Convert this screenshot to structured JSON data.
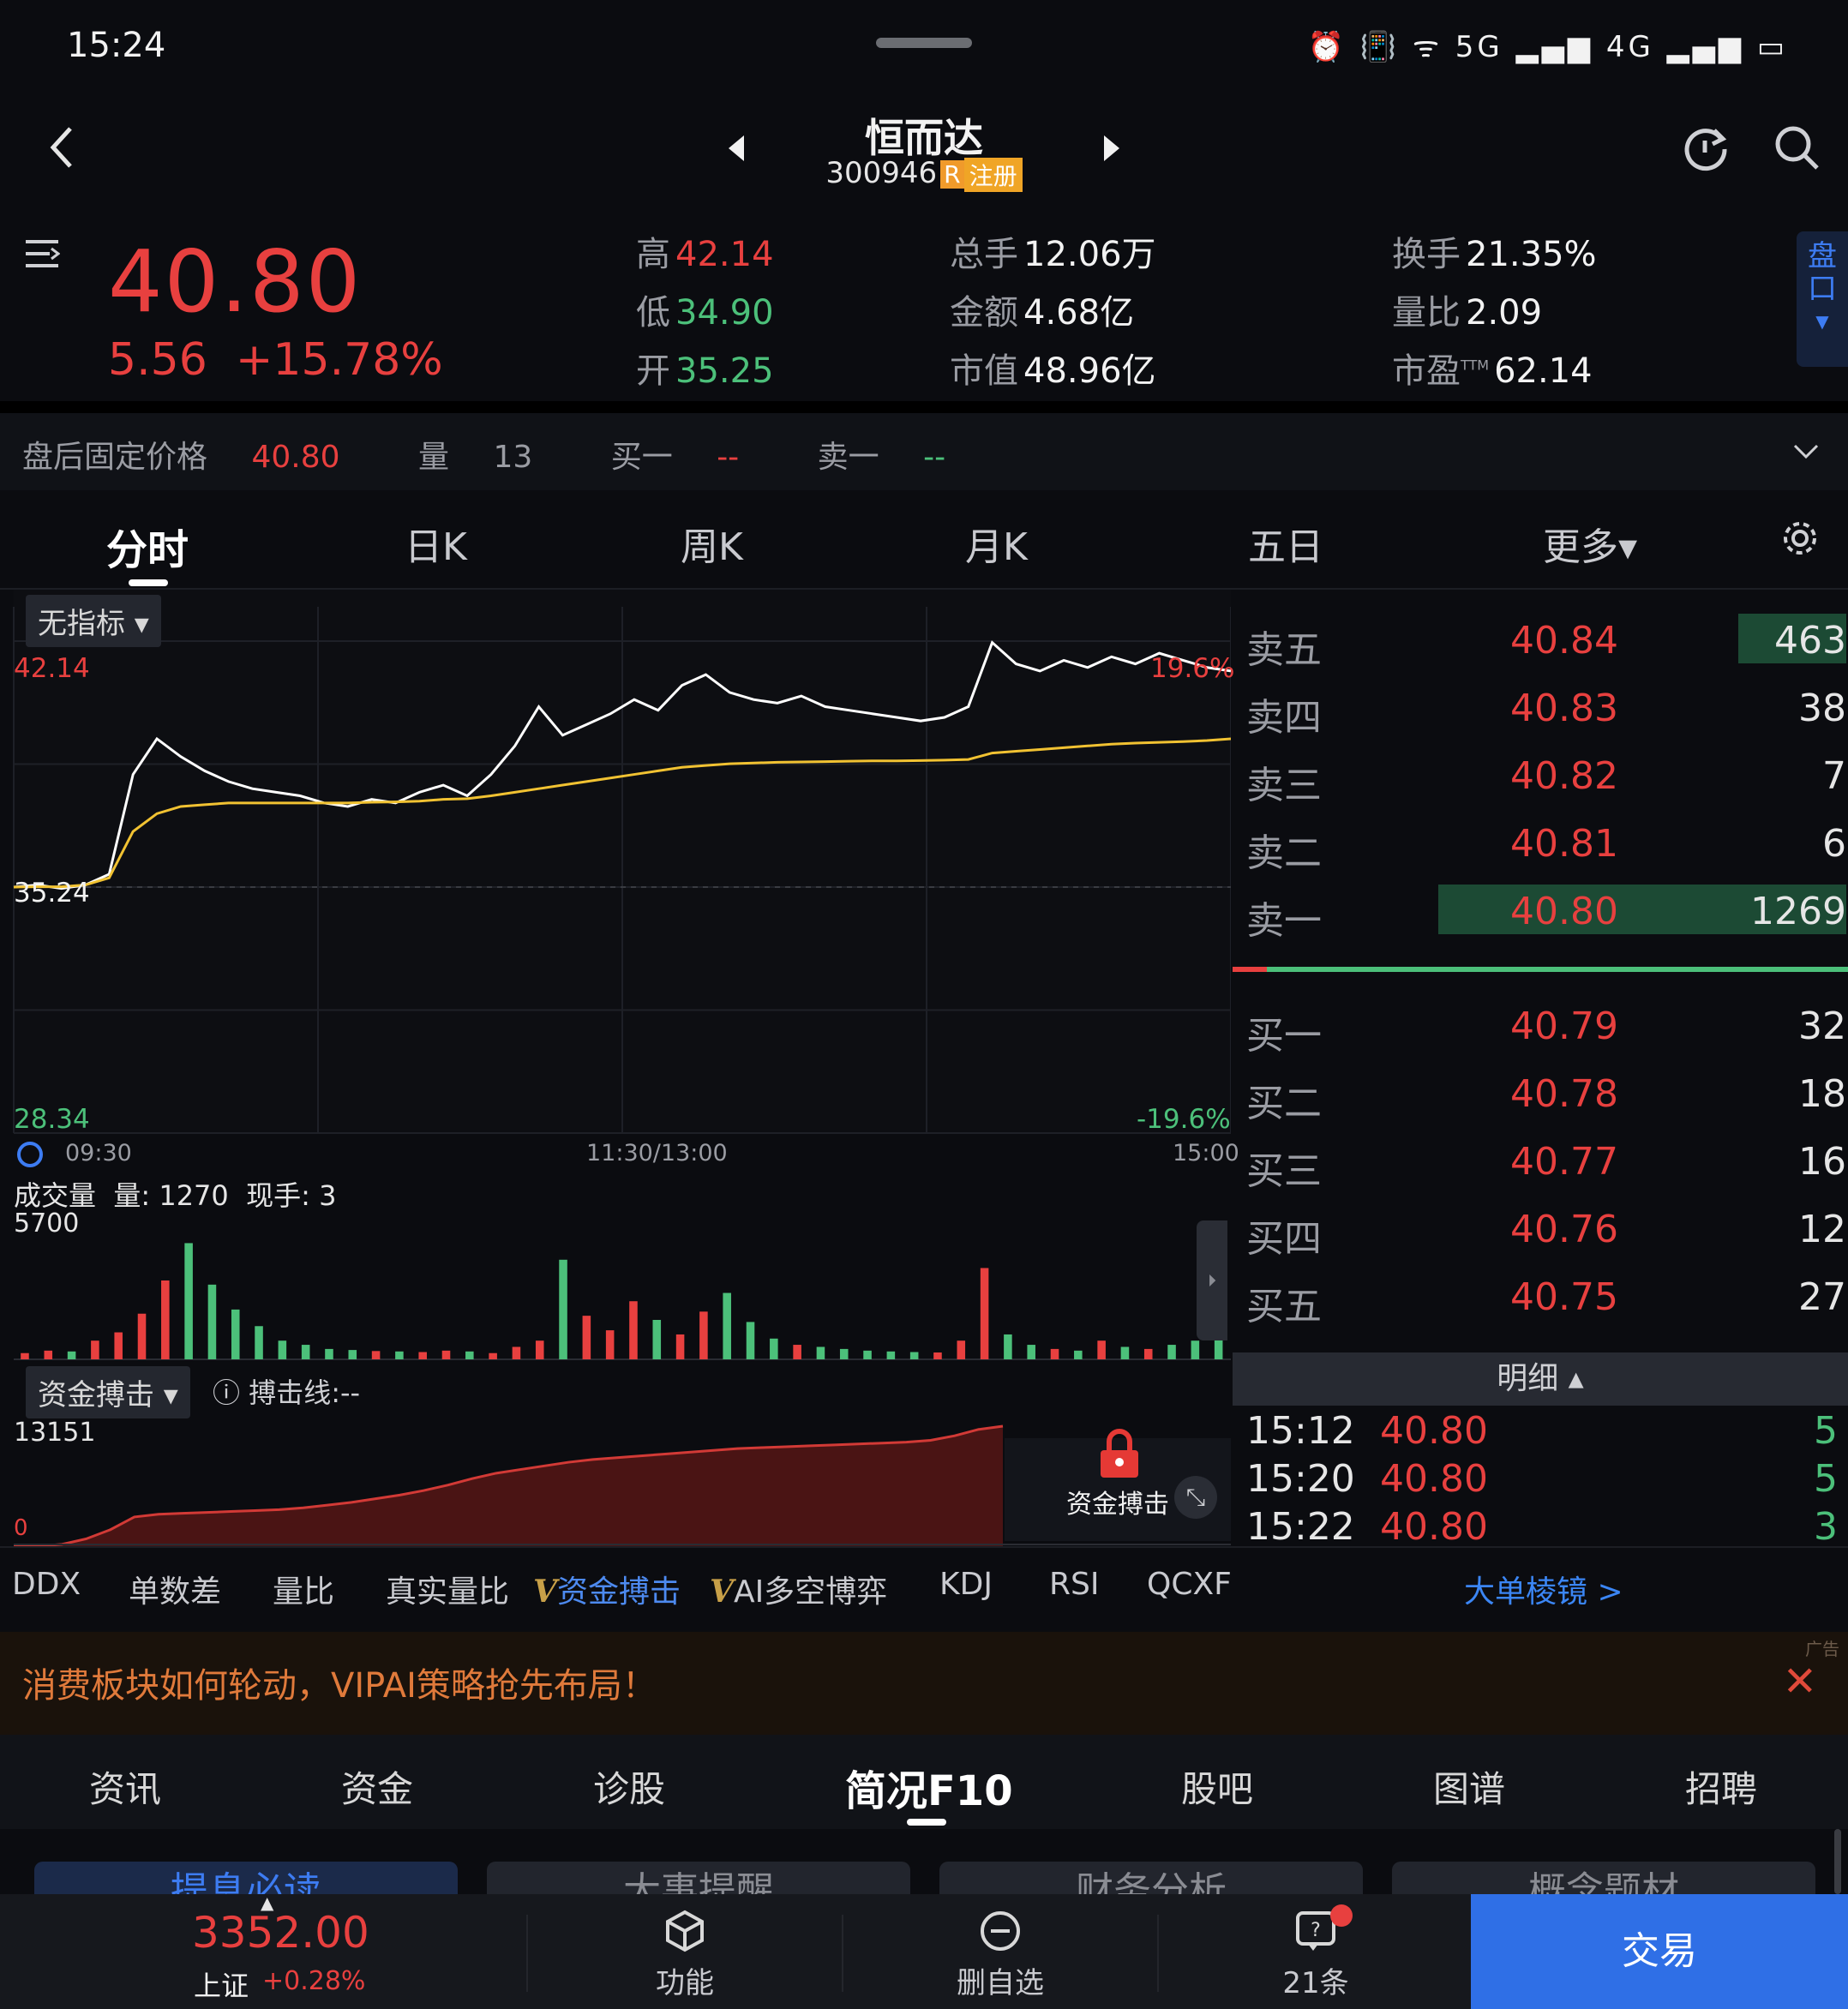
{
  "status_bar": {
    "time": "15:24",
    "icons_text": "⏰ 📳 ᯤ 5G ▂▄▆ 4G ▂▄▆ ▭"
  },
  "title": {
    "name": "恒而达",
    "code": "300946",
    "badge_r": "R",
    "badge_reg": "注册"
  },
  "quote": {
    "price": "40.80",
    "change": "5.56",
    "change_pct": "+15.78%",
    "high_label": "高",
    "high": "42.14",
    "low_label": "低",
    "low": "34.90",
    "open_label": "开",
    "open": "35.25",
    "vol_label": "总手",
    "vol": "12.06万",
    "amount_label": "金额",
    "amount": "4.68亿",
    "mcap_label": "市值",
    "mcap": "48.96亿",
    "turnover_label": "换手",
    "turnover": "21.35%",
    "volratio_label": "量比",
    "volratio": "2.09",
    "pe_label": "市盈",
    "pe_sup": "TTM",
    "pe": "62.14",
    "pankou": "盘口"
  },
  "afterhours": {
    "price_label": "盘后固定价格",
    "price": "40.80",
    "vol_label": "量",
    "vol": "13",
    "buy1_label": "买一",
    "buy1": "--",
    "sell1_label": "卖一",
    "sell1": "--"
  },
  "tabs": [
    "分时",
    "日K",
    "周K",
    "月K",
    "五日",
    "更多▾"
  ],
  "chart": {
    "indicator_select": "无指标 ▾",
    "y_top": "42.14",
    "y_mid": "35.24",
    "y_bottom": "28.34",
    "pct_top": "19.6%",
    "pct_bottom": "-19.6%",
    "t_start": "09:30",
    "t_mid": "11:30/13:00",
    "t_end": "15:00",
    "volume_title": "成交量",
    "volume_now_label": "量:",
    "volume_now": "1270",
    "hand_label": "现手:",
    "hand": "3",
    "volume_max": "5700",
    "fund_select": "资金搏击 ▾",
    "fund_line_label": "搏击线:--",
    "fund_max": "13151",
    "fund_zero": "0",
    "lock_label": "资金搏击"
  },
  "chart_data": {
    "type": "line",
    "title": "",
    "x_range": [
      "09:30",
      "15:00"
    ],
    "ylim": [
      28.34,
      42.14
    ],
    "prev_close": 35.24,
    "series": [
      {
        "name": "",
        "color": "#ffffff",
        "values": [
          35.24,
          35.3,
          35.2,
          35.3,
          35.6,
          38.4,
          39.4,
          38.9,
          38.5,
          38.2,
          38.0,
          37.9,
          37.8,
          37.6,
          37.5,
          37.7,
          37.6,
          37.9,
          38.1,
          37.8,
          38.4,
          39.2,
          40.3,
          39.5,
          39.8,
          40.1,
          40.5,
          40.2,
          40.9,
          41.2,
          40.7,
          40.5,
          40.4,
          40.6,
          40.3,
          40.2,
          40.1,
          40.0,
          39.9,
          40.0,
          40.3,
          42.1,
          41.5,
          41.3,
          41.6,
          41.4,
          41.7,
          41.5,
          41.8,
          41.6,
          41.4,
          41.3
        ]
      },
      {
        "name": "",
        "color": "#f1c232",
        "values": [
          35.24,
          35.25,
          35.25,
          35.3,
          35.5,
          36.8,
          37.3,
          37.5,
          37.55,
          37.6,
          37.6,
          37.6,
          37.6,
          37.6,
          37.6,
          37.62,
          37.63,
          37.65,
          37.7,
          37.72,
          37.8,
          37.9,
          38.0,
          38.1,
          38.2,
          38.3,
          38.4,
          38.5,
          38.6,
          38.65,
          38.7,
          38.72,
          38.74,
          38.75,
          38.76,
          38.77,
          38.78,
          38.78,
          38.79,
          38.8,
          38.82,
          39.0,
          39.05,
          39.1,
          39.15,
          39.2,
          39.25,
          39.28,
          39.3,
          39.32,
          39.35,
          39.4
        ]
      }
    ],
    "volume": {
      "ylim": [
        0,
        5700
      ],
      "values": [
        300,
        420,
        380,
        900,
        1300,
        2200,
        3800,
        5600,
        3600,
        2400,
        1600,
        900,
        700,
        500,
        450,
        400,
        380,
        350,
        420,
        380,
        300,
        600,
        900,
        4800,
        2100,
        1400,
        2800,
        1900,
        1200,
        2300,
        3200,
        1800,
        1000,
        700,
        600,
        500,
        420,
        380,
        350,
        330,
        900,
        4400,
        1200,
        700,
        500,
        420,
        900,
        600,
        500,
        700,
        900,
        1270
      ]
    },
    "fund_flow": {
      "ylim": [
        0,
        13151
      ],
      "values": [
        0,
        0,
        200,
        800,
        1800,
        3200,
        3500,
        3600,
        3700,
        3800,
        3900,
        4000,
        4200,
        4500,
        4800,
        5200,
        5600,
        6100,
        6700,
        7400,
        8000,
        8400,
        8800,
        9200,
        9500,
        9700,
        9900,
        10100,
        10300,
        10500,
        10700,
        10800,
        10900,
        11000,
        11100,
        11200,
        11300,
        11400,
        11600,
        12100,
        12800,
        13151
      ]
    }
  },
  "orderbook": {
    "asks": [
      {
        "label": "卖五",
        "price": "40.84",
        "vol": "463",
        "bar": 0.18
      },
      {
        "label": "卖四",
        "price": "40.83",
        "vol": "38",
        "bar": 0
      },
      {
        "label": "卖三",
        "price": "40.82",
        "vol": "7",
        "bar": 0
      },
      {
        "label": "卖二",
        "price": "40.81",
        "vol": "6",
        "bar": 0
      },
      {
        "label": "卖一",
        "price": "40.80",
        "vol": "1269",
        "bar": 0.68
      }
    ],
    "bids": [
      {
        "label": "买一",
        "price": "40.79",
        "vol": "32"
      },
      {
        "label": "买二",
        "price": "40.78",
        "vol": "18"
      },
      {
        "label": "买三",
        "price": "40.77",
        "vol": "16"
      },
      {
        "label": "买四",
        "price": "40.76",
        "vol": "12"
      },
      {
        "label": "买五",
        "price": "40.75",
        "vol": "27"
      }
    ],
    "detail_label": "明细 ▴",
    "trades": [
      {
        "time": "15:12",
        "price": "40.80",
        "qty": "5"
      },
      {
        "time": "15:20",
        "price": "40.80",
        "qty": "5"
      },
      {
        "time": "15:22",
        "price": "40.80",
        "qty": "3"
      }
    ]
  },
  "indicator_tabs": {
    "items": [
      "DDX",
      "单数差",
      "量比",
      "真实量比"
    ],
    "vip1_mark": "V",
    "vip1": "资金搏击",
    "vip2_mark": "V",
    "vip2": "AI多空博弈",
    "items2": [
      "KDJ",
      "RSI",
      "QCXF"
    ],
    "big_order": "大单棱镜 >"
  },
  "ad": {
    "text": "消费板块如何轮动，VIPAI策略抢先布局！",
    "tag": "广告",
    "close": "✕"
  },
  "f10_tabs": [
    "资讯",
    "资金",
    "诊股",
    "简况F10",
    "股吧",
    "图谱",
    "招聘"
  ],
  "sub_cards": [
    "提息必读",
    "大事提醒",
    "财务分析",
    "概念题材"
  ],
  "bottom_bar": {
    "index_value": "3352.00",
    "index_name": "上证",
    "index_change": "+0.28%",
    "func_label": "功能",
    "remove_label": "删自选",
    "ask_label": "21条",
    "trade_label": "交易"
  }
}
